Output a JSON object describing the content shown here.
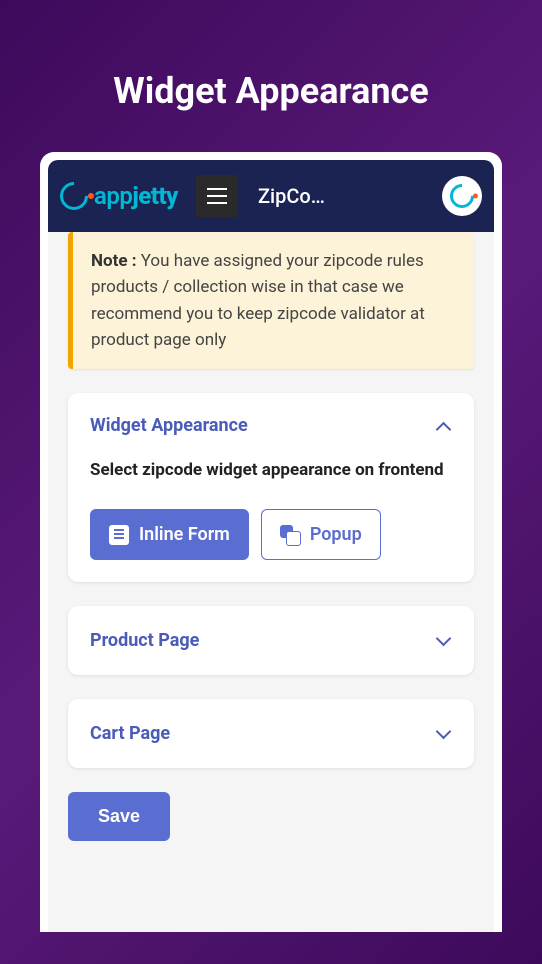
{
  "page": {
    "title": "Widget Appearance"
  },
  "header": {
    "brand_a": "app",
    "brand_b": "jetty",
    "title": "ZipCo…"
  },
  "note": {
    "label": "Note :",
    "text": " You have assigned your zipcode rules products / collection wise in that case we recommend you to keep zipcode validator at product page only"
  },
  "widget_card": {
    "title": "Widget Appearance",
    "subtitle": "Select zipcode widget appearance on frontend",
    "options": {
      "inline": "Inline Form",
      "popup": "Popup"
    }
  },
  "product_card": {
    "title": "Product Page"
  },
  "cart_card": {
    "title": "Cart Page"
  },
  "actions": {
    "save": "Save"
  }
}
